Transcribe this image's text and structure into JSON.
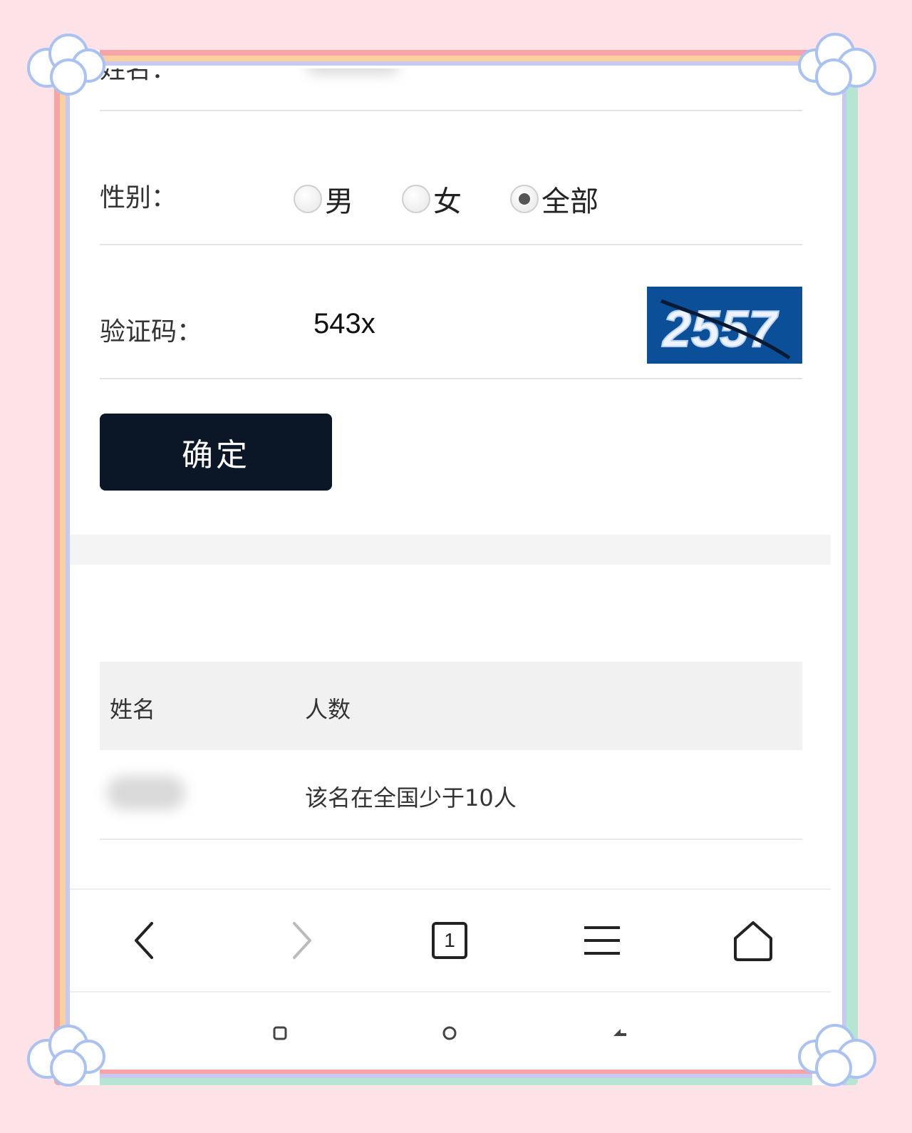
{
  "form": {
    "name_label_partial": "姓名：",
    "gender_label": "性别：",
    "gender_options": [
      "男",
      "女",
      "全部"
    ],
    "gender_selected": "全部",
    "captcha_label": "验证码：",
    "captcha_value": "543x",
    "captcha_image_text": "2557",
    "confirm_label": "确定"
  },
  "results": {
    "headers": [
      "姓名",
      "人数"
    ],
    "rows": [
      {
        "name": "",
        "count": "该名在全国少于10人"
      }
    ]
  },
  "browser_nav": {
    "tab_count": "1"
  },
  "colors": {
    "confirm_bg": "#0b1627",
    "captcha_bg": "#0b4f98",
    "page_bg": "#fde3e8"
  }
}
